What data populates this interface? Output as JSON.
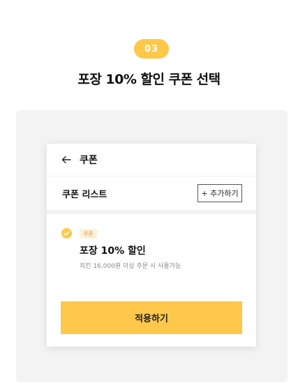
{
  "step": {
    "badge": "03",
    "title": "포장 10% 할인 쿠폰 선택"
  },
  "colors": {
    "accent": "#ffc84a",
    "tag_text": "#f08a1c",
    "tag_bg": "#fff1dc"
  },
  "screen": {
    "header": {
      "back_icon": "arrow-left-icon",
      "title": "쿠폰"
    },
    "list": {
      "title": "쿠폰 리스트",
      "add_label": "+ 추가하기"
    },
    "coupon": {
      "selected": true,
      "check_icon": "check-circle-icon",
      "tag": "쿠폰",
      "name": "포장 10% 할인",
      "description": "치킨 16,000원 이상 주문 시 사용가능"
    },
    "apply_label": "적용하기"
  }
}
